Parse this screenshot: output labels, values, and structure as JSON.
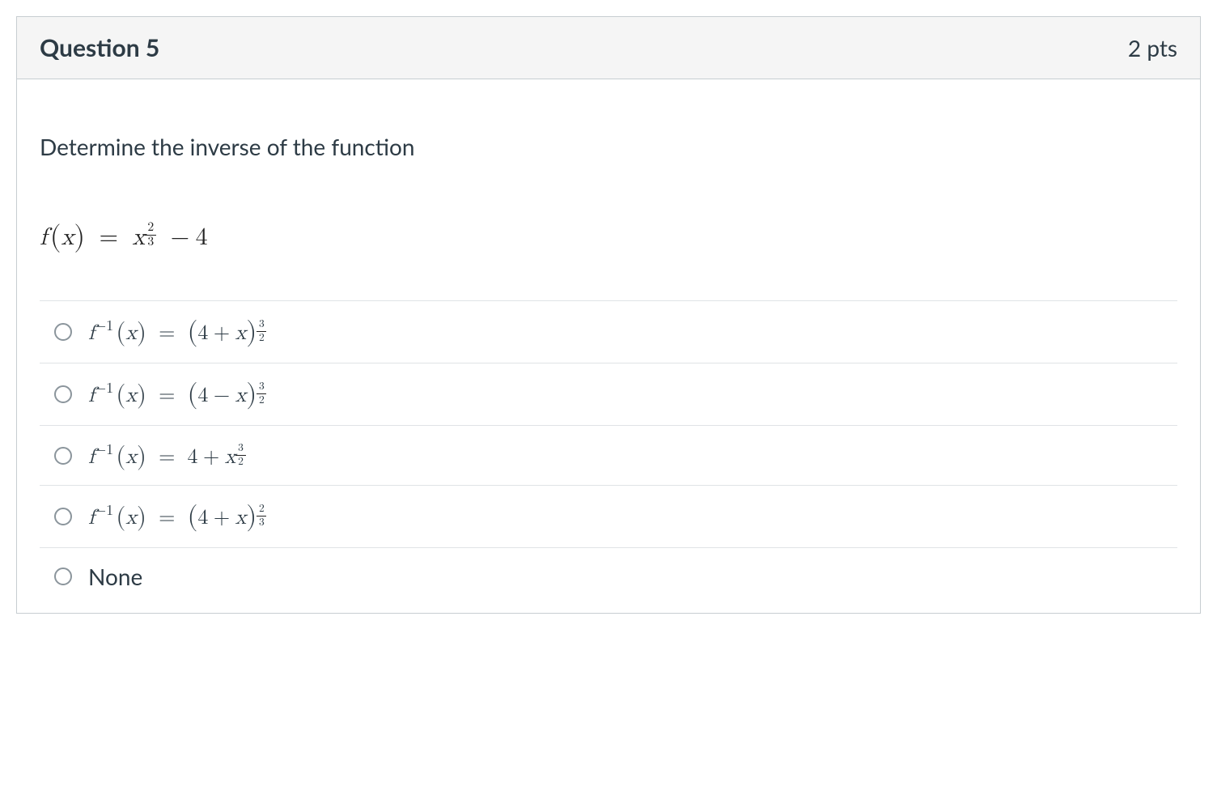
{
  "question": {
    "title": "Question 5",
    "points": "2 pts",
    "prompt": "Determine the inverse of the function",
    "function": {
      "lhs_fn": "f",
      "lhs_arg": "x",
      "rhs_base": "x",
      "rhs_exp_num": "2",
      "rhs_exp_den": "3",
      "rhs_op": "−",
      "rhs_const": "4"
    },
    "options": [
      {
        "kind": "inverse_paren_pow",
        "lhs_fn": "f",
        "lhs_exp": "−1",
        "lhs_arg": "x",
        "inner_left": "4",
        "inner_op": "+",
        "inner_right": "x",
        "pow_num": "3",
        "pow_den": "2"
      },
      {
        "kind": "inverse_paren_pow",
        "lhs_fn": "f",
        "lhs_exp": "−1",
        "lhs_arg": "x",
        "inner_left": "4",
        "inner_op": "−",
        "inner_right": "x",
        "pow_num": "3",
        "pow_den": "2"
      },
      {
        "kind": "inverse_plain_pow",
        "lhs_fn": "f",
        "lhs_exp": "−1",
        "lhs_arg": "x",
        "left_const": "4",
        "op": "+",
        "base": "x",
        "pow_num": "3",
        "pow_den": "2"
      },
      {
        "kind": "inverse_paren_pow",
        "lhs_fn": "f",
        "lhs_exp": "−1",
        "lhs_arg": "x",
        "inner_left": "4",
        "inner_op": "+",
        "inner_right": "x",
        "pow_num": "2",
        "pow_den": "3"
      },
      {
        "kind": "plain",
        "text": "None"
      }
    ]
  }
}
